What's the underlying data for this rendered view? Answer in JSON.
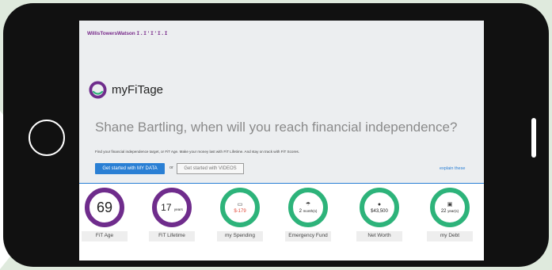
{
  "brand": {
    "company_name": "WillisTowersWatson",
    "company_mark": "I.I'I'I.I",
    "app_name": "myFiTage"
  },
  "colors": {
    "accent_blue": "#2a7fd4",
    "brand_purple": "#6f2c8c",
    "metric_green": "#2db37a",
    "negative_red": "#e04a3a"
  },
  "hero": {
    "headline": "Shane Bartling, when will you reach financial independence?",
    "subtext": "Find your financial independence target, or FiT Age. Make your money last with FiT Lifetime. And stay on track with FiT Scores.",
    "primary_button": "Get started with MY DATA",
    "or_text": "or",
    "secondary_button": "Get started with VIDEOS",
    "explain_link": "explain these"
  },
  "metrics": [
    {
      "label": "FiT Age",
      "value": "69",
      "unit": "",
      "icon": "none",
      "color": "purple"
    },
    {
      "label": "FiT Lifetime",
      "value": "17",
      "unit": "years",
      "icon": "none",
      "color": "purple"
    },
    {
      "label": "my Spending",
      "value": "$-179",
      "unit": "",
      "icon": "wallet-icon",
      "color": "green"
    },
    {
      "label": "Emergency Fund",
      "value": "2",
      "unit": "month(s)",
      "icon": "umbrella-icon",
      "color": "green"
    },
    {
      "label": "Net Worth",
      "value": "$43,500",
      "unit": "",
      "icon": "coins-icon",
      "color": "green"
    },
    {
      "label": "my Debt",
      "value": "22",
      "unit": "year(s)",
      "icon": "money-bag-icon",
      "color": "green"
    }
  ]
}
